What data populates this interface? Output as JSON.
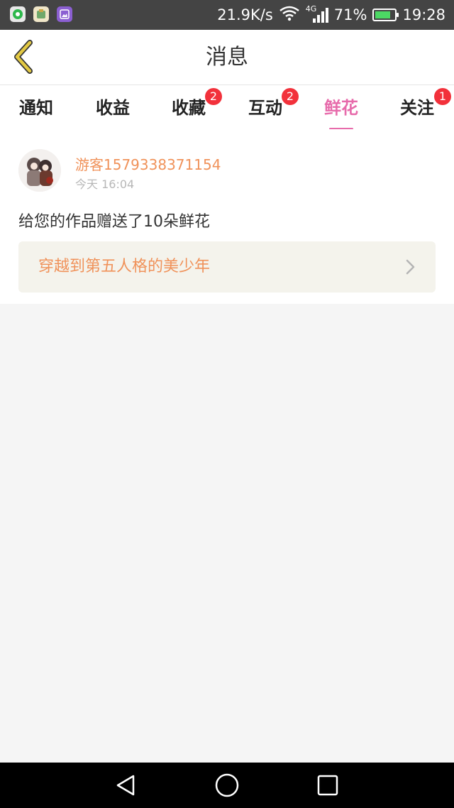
{
  "status_bar": {
    "net_speed": "21.9K/s",
    "signal_type": "4G",
    "battery_percent": "71%",
    "time": "19:28",
    "icons": [
      "app-icon-1",
      "app-icon-2",
      "gallery-icon",
      "wifi-icon",
      "signal-icon",
      "battery-icon"
    ]
  },
  "header": {
    "title": "消息"
  },
  "tabs": [
    {
      "label": "通知",
      "badge": ""
    },
    {
      "label": "收益",
      "badge": ""
    },
    {
      "label": "收藏",
      "badge": "2"
    },
    {
      "label": "互动",
      "badge": "2"
    },
    {
      "label": "鲜花",
      "badge": "",
      "active": true
    },
    {
      "label": "关注",
      "badge": "1"
    }
  ],
  "message": {
    "username": "游客1579338371154",
    "time": "今天 16:04",
    "text": "给您的作品赠送了10朵鲜花",
    "work_title": "穿越到第五人格的美少年"
  },
  "colors": {
    "accent_pink": "#e76bab",
    "orange_text": "#f0925a",
    "badge_red": "#f2313b",
    "back_arrow": "#e3c944"
  }
}
